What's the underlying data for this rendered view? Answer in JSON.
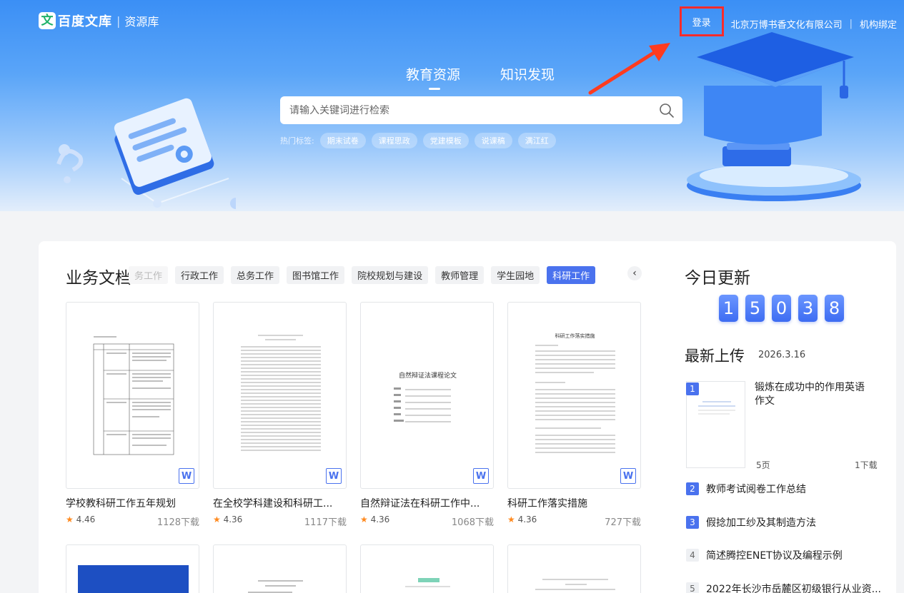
{
  "header": {
    "logo_mark": "文",
    "logo_name": "百度文库",
    "logo_sep": "|",
    "logo_sub": "资源库",
    "login": "登录",
    "org_name": "北京万博书香文化有限公司",
    "nav_sep": "|",
    "org_bind": "机构绑定"
  },
  "hero": {
    "tabs": [
      {
        "label": "教育资源"
      },
      {
        "label": "知识发现"
      }
    ],
    "search_placeholder": "请输入关键词进行检索",
    "hot_label": "热门标签:",
    "hot_tags": [
      "期末试卷",
      "课程思政",
      "党建模板",
      "说课稿",
      "满江红"
    ]
  },
  "business": {
    "title": "业务文档",
    "categories": [
      "务工作",
      "行政工作",
      "总务工作",
      "图书馆工作",
      "院校规划与建设",
      "教师管理",
      "学生园地",
      "科研工作"
    ],
    "active_category": "科研工作",
    "scroll_arrow": "‹",
    "docs": [
      {
        "title": "学校教科研工作五年规划",
        "rating": "4.46",
        "downloads": "1128下载",
        "type": "W"
      },
      {
        "title": "在全校学科建设和科研工...",
        "rating": "4.36",
        "downloads": "1117下载",
        "type": "W"
      },
      {
        "title": "自然辩证法在科研工作中...",
        "rating": "4.36",
        "downloads": "1068下载",
        "type": "W"
      },
      {
        "title": "科研工作落实措施",
        "rating": "4.36",
        "downloads": "727下载",
        "type": "W"
      }
    ],
    "star": "★"
  },
  "thumb_text": {
    "doc3_title": "自然辩证法课程论文",
    "doc4_title": "科研工作落实措施"
  },
  "today": {
    "title": "今日更新",
    "digits": [
      "1",
      "5",
      "0",
      "3",
      "8"
    ]
  },
  "latest": {
    "title": "最新上传",
    "date": "2026.3.16",
    "first": {
      "rank": "1",
      "title": "锻炼在成功中的作用英语作文",
      "pages": "5页",
      "downloads": "1下载"
    },
    "items": [
      {
        "rank": "2",
        "title": "教师考试阅卷工作总结"
      },
      {
        "rank": "3",
        "title": "假捻加工纱及其制造方法"
      },
      {
        "rank": "4",
        "title": "简述腾控ENET协议及编程示例"
      },
      {
        "rank": "5",
        "title": "2022年长沙市岳麓区初级银行从业资..."
      }
    ]
  },
  "colors": {
    "accent": "#4a72ee",
    "highlight_box": "#ff2b2b",
    "arrow": "#ff3b1f",
    "star": "#ff8a1f"
  }
}
